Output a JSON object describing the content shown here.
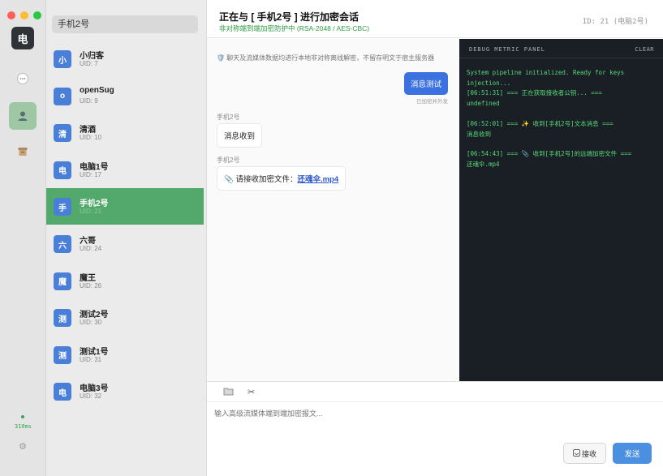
{
  "rail": {
    "avatar_char": "电",
    "latency": "310ms",
    "icons": [
      "chat-icon",
      "user-icon",
      "archive-icon",
      "gear-icon"
    ]
  },
  "search": {
    "value": "手机2号"
  },
  "contacts": [
    {
      "char": "小",
      "name": "小归客",
      "uid": "UID: 7"
    },
    {
      "char": "o",
      "name": "openSug",
      "uid": "UID: 9"
    },
    {
      "char": "清",
      "name": "清酒",
      "uid": "UID: 10"
    },
    {
      "char": "电",
      "name": "电脑1号",
      "uid": "UID: 17"
    },
    {
      "char": "手",
      "name": "手机2号",
      "uid": "UID: 21",
      "active": true
    },
    {
      "char": "六",
      "name": "六哥",
      "uid": "UID: 24"
    },
    {
      "char": "魔",
      "name": "魔王",
      "uid": "UID: 26"
    },
    {
      "char": "测",
      "name": "测试2号",
      "uid": "UID: 30"
    },
    {
      "char": "测",
      "name": "测试1号",
      "uid": "UID: 31"
    },
    {
      "char": "电",
      "name": "电脑3号",
      "uid": "UID: 32"
    }
  ],
  "header": {
    "title": "正在与 [ 手机2号 ] 进行加密会话",
    "subtitle": "非对称端到端加密防护中 (RSA-2048 / AES-CBC)",
    "id_text": "ID: 21 (电脑2号)"
  },
  "chat": {
    "notice": "🛡️ 聊天及流媒体数据均进行本地非对称离线解密，不留存明文于宿主服务器",
    "outgoing": {
      "text": "消息测试",
      "status": "已加密并外发"
    },
    "incoming": [
      {
        "sender": "手机2号",
        "text": "消息收到"
      },
      {
        "sender": "手机2号",
        "prefix": "📎 请接收加密文件：",
        "file": "还魂伞.mp4"
      }
    ]
  },
  "debug": {
    "title": "DEBUG METRIC PANEL",
    "clear": "CLEAR",
    "logs": [
      [
        "System pipeline initialized. Ready for keys",
        "injection..."
      ],
      [
        "[06:51:31] === 正在获取接收者公钥... ===",
        "undefined"
      ],
      [
        "[06:52:01] === ✨ 收到[手机2号]文本消息 ===",
        "消息收到"
      ],
      [
        "[06:54:43] === 📎 收到[手机2号]的远端加密文件 ===",
        "还魂伞.mp4"
      ]
    ]
  },
  "composer": {
    "placeholder": "输入高级流媒体端到端加密报文...",
    "receive_label": "接收",
    "send_label": "发送"
  }
}
